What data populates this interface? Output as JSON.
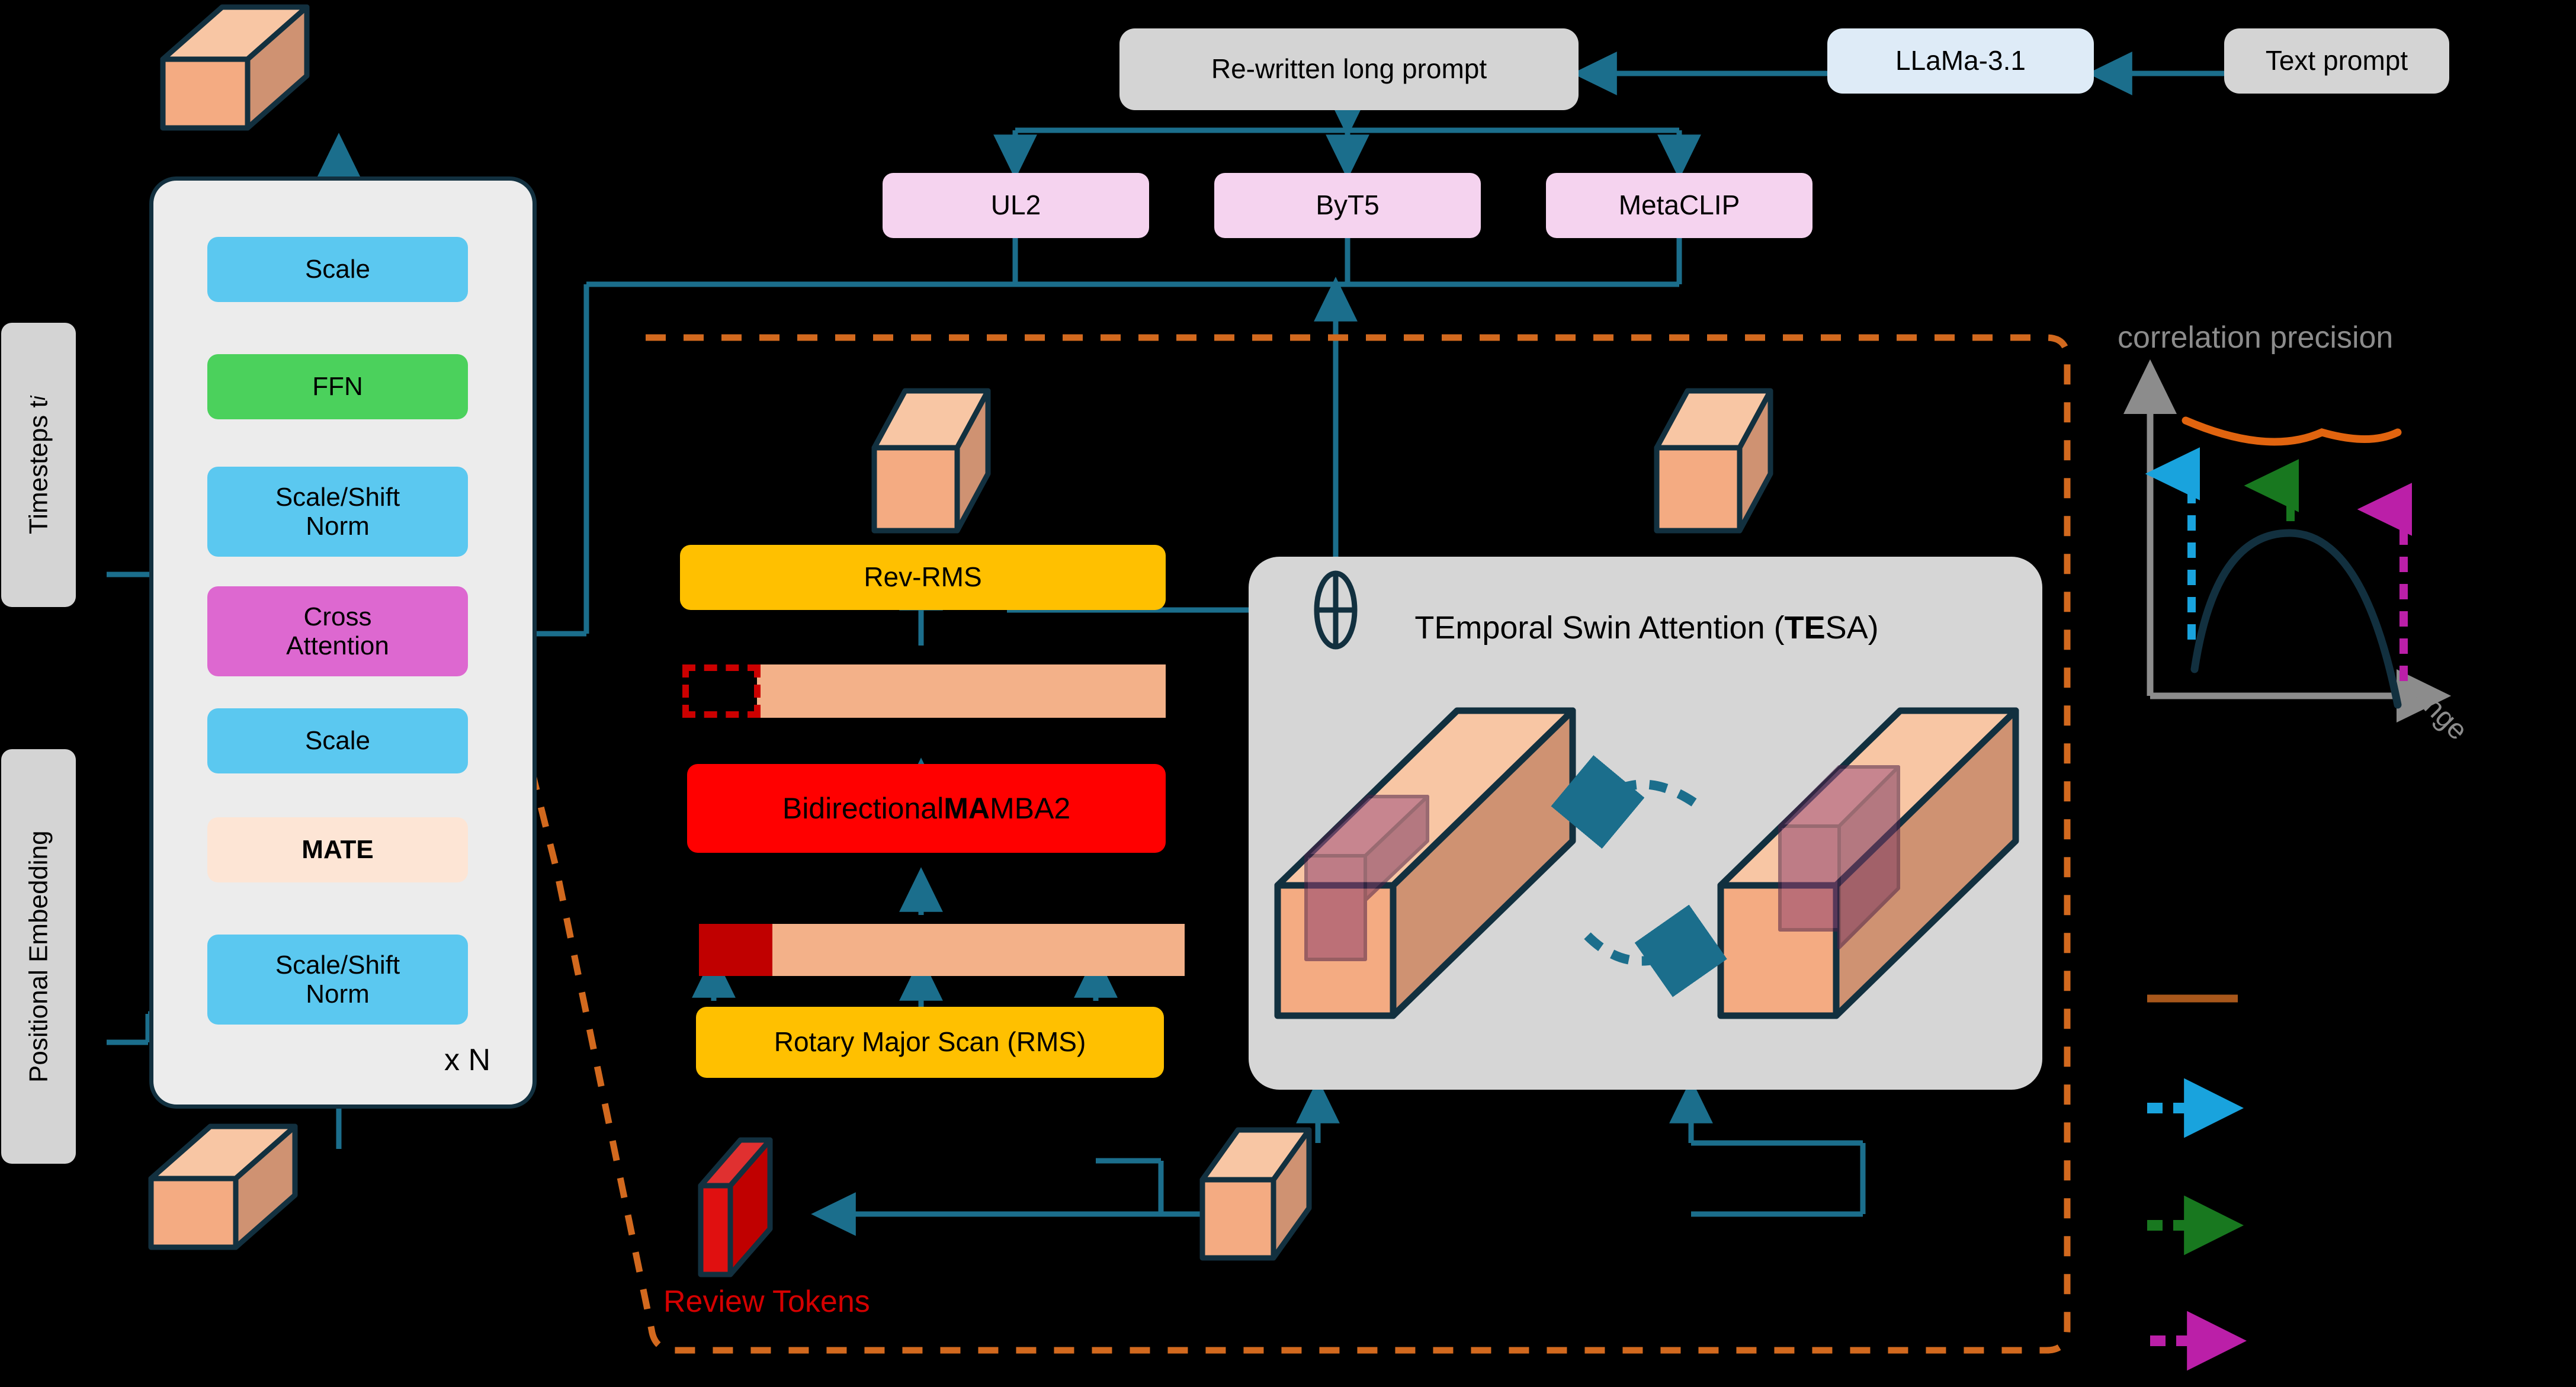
{
  "diagram": {
    "title_hidden": "",
    "colors": {
      "background": "#000000",
      "arrow": "#1b6e8c",
      "outline": "#12303f",
      "dashed_region": "#d2691e",
      "review_red": "#cc0000",
      "token_peach": "#f3b189",
      "cube_top": "#f8c6a4",
      "cube_front": "#f4ab82",
      "cube_side": "#cf9272",
      "chart_curve": "#12303f",
      "chart_trend": "#e1640f",
      "legend_brown": "#a8571b",
      "legend_blue": "#19a3dd",
      "legend_green": "#18781f",
      "legend_magenta": "#bb1fa8",
      "axis_gray": "#8c8c8c"
    }
  },
  "text_pipeline": {
    "text_prompt": "Text prompt",
    "llm": "LLaMa-3.1",
    "rewritten": "Re-written long prompt",
    "encoders": [
      {
        "label": "UL2"
      },
      {
        "label": "ByT5"
      },
      {
        "label": "MetaCLIP"
      }
    ]
  },
  "dit_block": {
    "repeat_label": "x N",
    "inputs": [
      {
        "label": "Timesteps t",
        "sub": "i"
      },
      {
        "label": "Positional Embedding"
      }
    ],
    "layers": [
      {
        "label": "Scale",
        "kind": "cyan"
      },
      {
        "label": "FFN",
        "kind": "green"
      },
      {
        "label": "Scale/Shift\nNorm",
        "kind": "cyan"
      },
      {
        "label": "Cross\nAttention",
        "kind": "magenta"
      },
      {
        "label": "Scale",
        "kind": "cyan"
      },
      {
        "label": "MATE",
        "kind": "peach"
      },
      {
        "label": "Scale/Shift\nNorm",
        "kind": "cyan"
      }
    ]
  },
  "mamba_branch": {
    "rev_rms": "Rev-RMS",
    "bidirectional": {
      "prefix": "Bidirectional ",
      "bold": "MA",
      "suffix": "MBA2"
    },
    "rms": "Rotary Major Scan (RMS)",
    "review_tokens": "Review Tokens"
  },
  "tesa": {
    "title": {
      "prefix": "TEmporal Swin Attention (",
      "bold": "TE",
      "suffix": "SA)"
    }
  },
  "inset_chart": {
    "title": "correlation precision",
    "xlabel": "range"
  },
  "chart_data": {
    "type": "line",
    "title": "correlation precision",
    "xlabel": "range",
    "ylabel": "correlation precision",
    "grid": false,
    "legend": "none",
    "xlim": [
      0,
      10
    ],
    "ylim": [
      0,
      10
    ],
    "series": [
      {
        "name": "trend",
        "color": "#e1640f",
        "style": "solid",
        "x": [
          1.2,
          2.5,
          4.0,
          5.5,
          7.0,
          8.2
        ],
        "y": [
          8.6,
          8.3,
          8.0,
          7.8,
          7.65,
          7.6
        ]
      },
      {
        "name": "correlation",
        "color": "#12303f",
        "style": "solid",
        "x": [
          1.3,
          2.3,
          3.3,
          4.3,
          5.3,
          6.3,
          7.3,
          8.1
        ],
        "y": [
          3.2,
          5.0,
          6.2,
          6.6,
          6.3,
          5.3,
          3.6,
          2.4
        ]
      }
    ],
    "annotations": [
      {
        "name": "blue-gain",
        "color": "#19a3dd",
        "style": "dashed-arrow-up",
        "x": 1.4,
        "y0": 3.4,
        "y1": 7.7
      },
      {
        "name": "green-gain",
        "color": "#18781f",
        "style": "dashed-arrow-up",
        "x": 4.4,
        "y0": 6.2,
        "y1": 7.5
      },
      {
        "name": "magenta-gain",
        "color": "#bb1fa8",
        "style": "dashed-arrow-up",
        "x": 7.6,
        "y0": 2.7,
        "y1": 7.2
      }
    ]
  },
  "legend": {
    "items": [
      {
        "name": "trend-line",
        "color": "#a8571b",
        "style": "solid"
      },
      {
        "name": "blue-arrow",
        "color": "#19a3dd",
        "style": "dashed-arrow"
      },
      {
        "name": "green-arrow",
        "color": "#18781f",
        "style": "dashed-arrow"
      },
      {
        "name": "magenta-arrow",
        "color": "#bb1fa8",
        "style": "dashed-arrow"
      }
    ]
  }
}
